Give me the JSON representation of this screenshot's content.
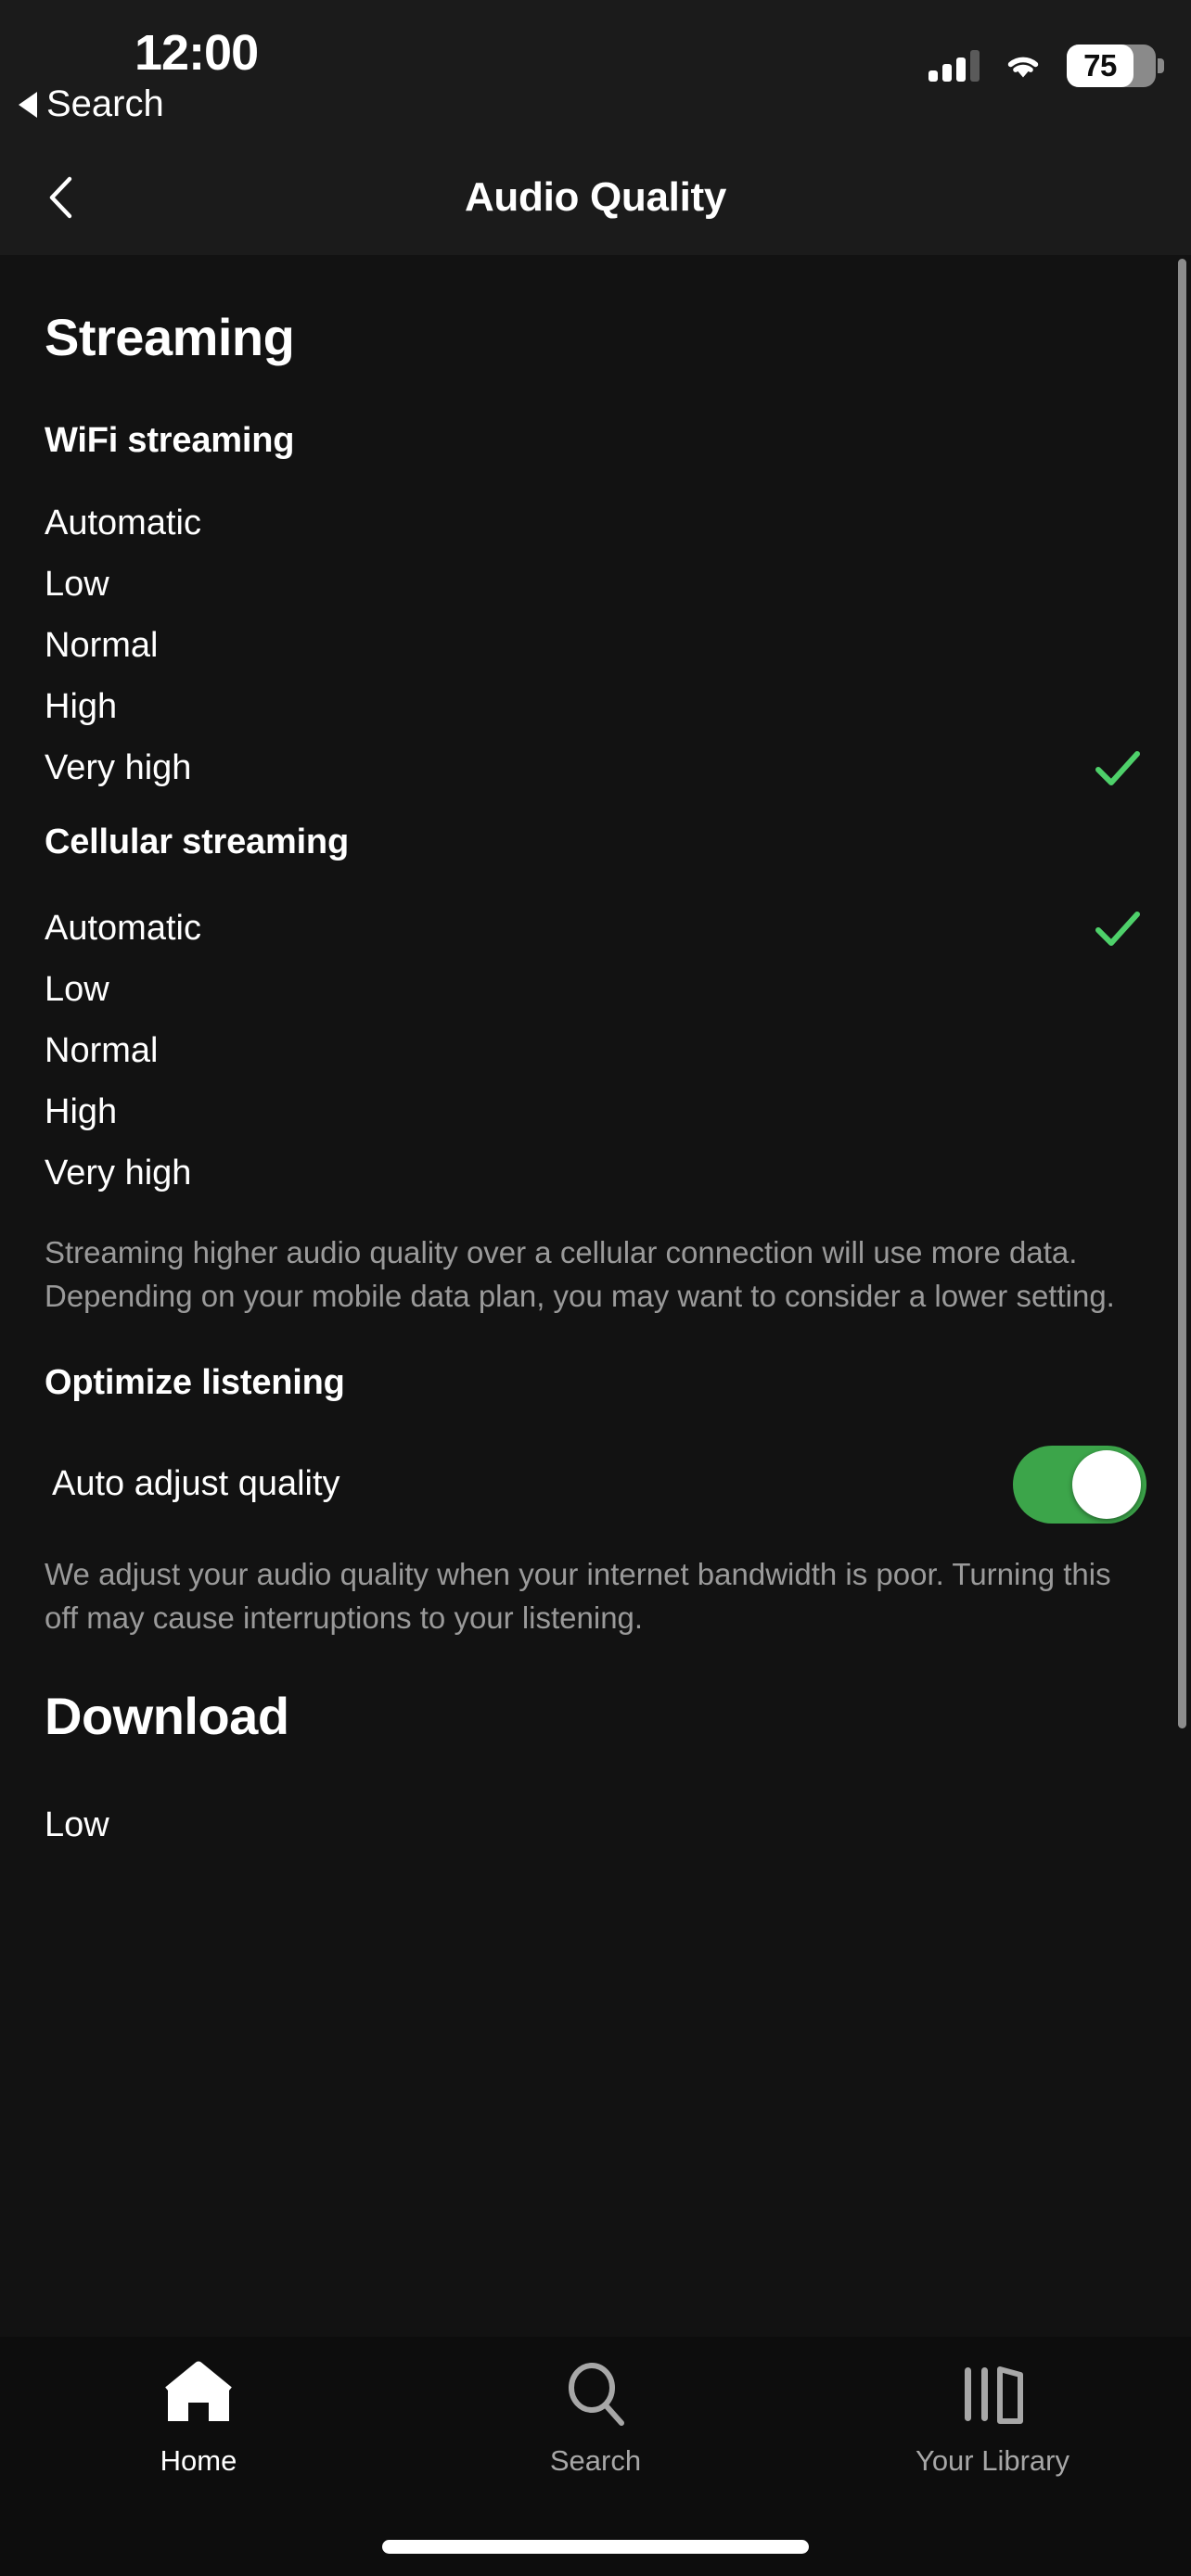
{
  "status_bar": {
    "time": "12:00",
    "back_label": "Search",
    "battery_percent": "75",
    "signal_bars_filled": 3,
    "signal_bars_total": 4,
    "wifi_icon": "wifi-icon",
    "battery_icon": "battery-icon"
  },
  "nav": {
    "title": "Audio Quality",
    "back_icon": "chevron-left-icon"
  },
  "streaming": {
    "section_title": "Streaming",
    "wifi": {
      "subheading": "WiFi streaming",
      "options": [
        {
          "label": "Automatic",
          "selected": false
        },
        {
          "label": "Low",
          "selected": false
        },
        {
          "label": "Normal",
          "selected": false
        },
        {
          "label": "High",
          "selected": false
        },
        {
          "label": "Very high",
          "selected": true
        }
      ]
    },
    "cellular": {
      "subheading": "Cellular streaming",
      "options": [
        {
          "label": "Automatic",
          "selected": true
        },
        {
          "label": "Low",
          "selected": false
        },
        {
          "label": "Normal",
          "selected": false
        },
        {
          "label": "High",
          "selected": false
        },
        {
          "label": "Very high",
          "selected": false
        }
      ],
      "description": "Streaming higher audio quality over a cellular connection will use more data. Depending on your mobile data plan, you may want to consider a lower setting."
    }
  },
  "optimize": {
    "section_title": "Optimize listening",
    "toggle_label": "Auto adjust quality",
    "toggle_on": true,
    "description": "We adjust your audio quality when your internet bandwidth is poor. Turning this off may cause interruptions to your listening."
  },
  "download": {
    "section_title": "Download",
    "first_option": "Low"
  },
  "tabbar": {
    "items": [
      {
        "label": "Home",
        "icon": "home-icon",
        "active": true
      },
      {
        "label": "Search",
        "icon": "search-icon",
        "active": false
      },
      {
        "label": "Your Library",
        "icon": "library-icon",
        "active": false
      }
    ]
  },
  "colors": {
    "accent_green": "#4ED06A",
    "toggle_green": "#3CA54A",
    "background": "#121212",
    "bar_background": "#1b1b1b",
    "muted_text": "#9a9a9a"
  }
}
